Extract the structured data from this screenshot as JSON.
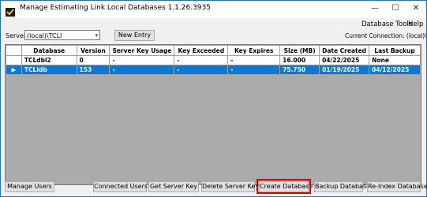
{
  "window": {
    "title": "Manage Estimating Link Local Databases 1.1.26.3935",
    "minimize": "—",
    "maximize": "☐",
    "close": "✕"
  },
  "menu": {
    "database_tools": "Database Tools",
    "help": "Help"
  },
  "toolbar": {
    "server_label": "Server",
    "server_value": "(local)\\TCLI",
    "new_entry": "New Entry",
    "current_connection": "Current Connection: (local)\\TCLI"
  },
  "table": {
    "columns": [
      "Database",
      "Version",
      "Server Key Usage",
      "Key Exceeded",
      "Key Expires",
      "Size (MB)",
      "Date Created",
      "Last Backup"
    ],
    "rows": [
      {
        "selected": false,
        "marker": "",
        "cells": [
          "TCLdbl2",
          "0",
          "-",
          "-",
          "-",
          "16.000",
          "04/22/2025",
          "None"
        ]
      },
      {
        "selected": true,
        "marker": "▶",
        "cells": [
          "TCLIdb",
          "153",
          "-",
          "-",
          "-",
          "75.750",
          "01/19/2025",
          "04/12/2025"
        ]
      }
    ]
  },
  "bottom_buttons": {
    "manage_users": "Manage Users",
    "connected_users": "Connected Users",
    "get_server_key": "Get Server Key",
    "delete_server_key": "Delete Server Key",
    "create_database": "Create Database",
    "backup_database": "Backup Database",
    "reindex_database": "Re-Index Database"
  },
  "colors": {
    "selection": "#0a78d7",
    "highlight_box": "#e00000",
    "window_border": "#1f6fd1"
  }
}
